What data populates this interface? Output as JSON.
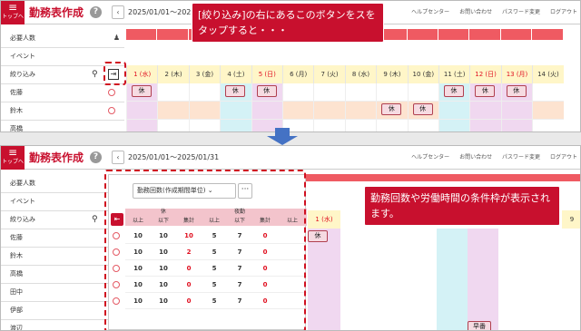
{
  "app": {
    "menu_sub": "トップへ",
    "title": "勤務表作成"
  },
  "header": {
    "date_range_top": "2025/01/01～2025/01/31",
    "date_range_bottom": "2025/01/01～2025/01/31",
    "links": [
      "ヘルプセンター",
      "お問い合わせ",
      "パスワード変更",
      "ログアウト"
    ]
  },
  "sidebar": {
    "required": "必要人数",
    "event": "イベント",
    "filter": "絞り込み"
  },
  "staff": [
    "佐藤",
    "鈴木",
    "高橋",
    "田中",
    "伊部",
    "渡辺"
  ],
  "days": [
    {
      "label": "1 (水)",
      "type": "holiday"
    },
    {
      "label": "2 (木)",
      "type": "weekday"
    },
    {
      "label": "3 (金)",
      "type": "weekday"
    },
    {
      "label": "4 (土)",
      "type": "sat"
    },
    {
      "label": "5 (日)",
      "type": "holiday"
    },
    {
      "label": "6 (月)",
      "type": "weekday"
    },
    {
      "label": "7 (火)",
      "type": "weekday"
    },
    {
      "label": "8 (水)",
      "type": "weekday"
    },
    {
      "label": "9 (木)",
      "type": "weekday"
    },
    {
      "label": "10 (金)",
      "type": "weekday"
    },
    {
      "label": "11 (土)",
      "type": "sat"
    },
    {
      "label": "12 (日)",
      "type": "holiday"
    },
    {
      "label": "13 (月)",
      "type": "holiday"
    },
    {
      "label": "14 (火)",
      "type": "weekday"
    }
  ],
  "shift_label": "休",
  "callouts": {
    "top": "[絞り込み]の右にあるこのボタンをスをタップすると・・・",
    "bottom": "勤務回数や労働時間の条件枠が表示されます。"
  },
  "panel": {
    "select": "勤務回数(作成期間単位)",
    "more": "···",
    "groups": [
      "休",
      "夜勤"
    ],
    "subheaders": [
      "以上",
      "以下",
      "集計",
      "以上",
      "以下",
      "集計",
      "以上"
    ],
    "rows": [
      [
        "10",
        "10",
        "10",
        "5",
        "7",
        "0"
      ],
      [
        "10",
        "10",
        "2",
        "5",
        "7",
        "0"
      ],
      [
        "10",
        "10",
        "0",
        "5",
        "7",
        "0"
      ],
      [
        "10",
        "10",
        "0",
        "5",
        "7",
        "0"
      ],
      [
        "10",
        "10",
        "0",
        "5",
        "7",
        "0"
      ]
    ]
  },
  "bottom_day_partial": "9",
  "bottom_cell_label": "早番",
  "colors": {
    "accent": "#c8102e",
    "holiday": "#e01020",
    "saturday": "#00a0c0",
    "arrow": "#4472c4"
  }
}
